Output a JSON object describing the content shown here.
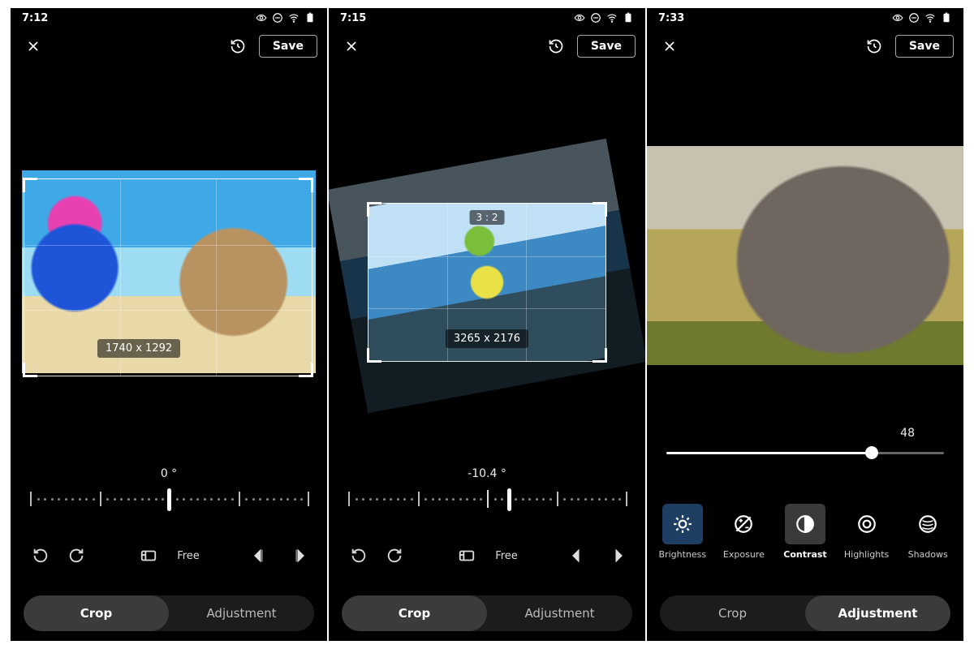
{
  "screens": [
    {
      "status_time": "7:12",
      "save_label": "Save",
      "crop": {
        "dimensions_label": "1740 x 1292",
        "angle_label": "0 °",
        "aspect_label": "Free"
      },
      "tabs": {
        "crop": "Crop",
        "adjustment": "Adjustment",
        "active": "crop"
      }
    },
    {
      "status_time": "7:15",
      "save_label": "Save",
      "crop": {
        "dimensions_label": "3265 x 2176",
        "ratio_badge": "3 : 2",
        "angle_label": "-10.4 °",
        "aspect_label": "Free"
      },
      "tabs": {
        "crop": "Crop",
        "adjustment": "Adjustment",
        "active": "crop"
      }
    },
    {
      "status_time": "7:33",
      "save_label": "Save",
      "adjustment": {
        "value_label": "48",
        "value_pct": 74,
        "tools": [
          {
            "key": "brightness",
            "label": "Brightness"
          },
          {
            "key": "exposure",
            "label": "Exposure"
          },
          {
            "key": "contrast",
            "label": "Contrast"
          },
          {
            "key": "highlights",
            "label": "Highlights"
          },
          {
            "key": "shadows",
            "label": "Shadows"
          }
        ],
        "selected": "contrast",
        "highlighted": "brightness"
      },
      "tabs": {
        "crop": "Crop",
        "adjustment": "Adjustment",
        "active": "adjustment"
      }
    }
  ]
}
